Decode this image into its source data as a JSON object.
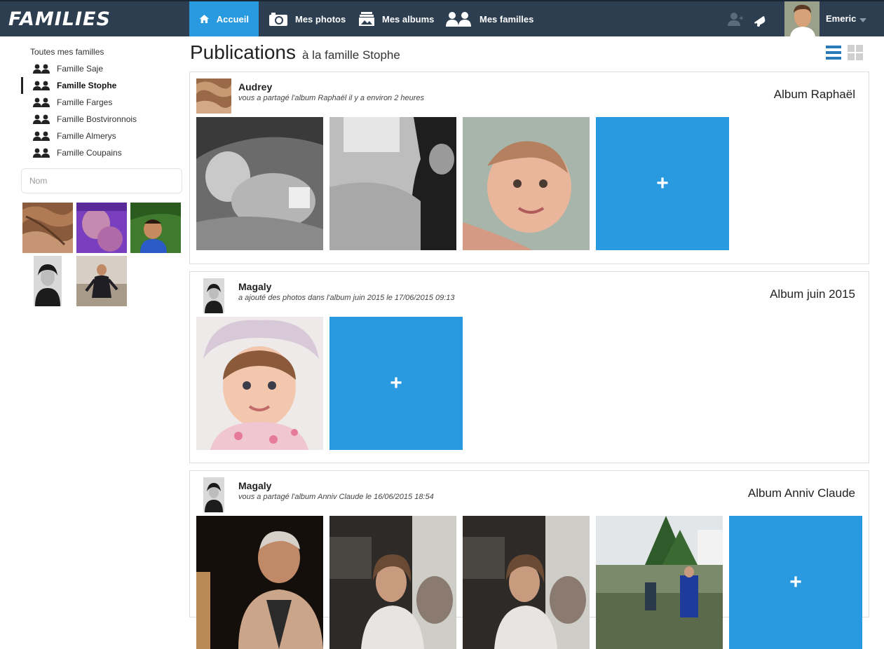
{
  "app": {
    "logo": "FAMILIES",
    "brand_color": "#2c3e50",
    "accent_color": "#2a9ae0"
  },
  "nav": {
    "items": [
      {
        "label": "Accueil",
        "icon": "home-icon",
        "active": true
      },
      {
        "label": "Mes photos",
        "icon": "camera-icon",
        "active": false
      },
      {
        "label": "Mes albums",
        "icon": "album-icon",
        "active": false
      },
      {
        "label": "Mes familles",
        "icon": "family-icon",
        "active": false
      }
    ]
  },
  "user": {
    "name": "Emeric"
  },
  "sidebar": {
    "title": "Toutes mes familles",
    "families": [
      {
        "label": "Famille Saje",
        "active": false
      },
      {
        "label": "Famille Stophe",
        "active": true
      },
      {
        "label": "Famille Farges",
        "active": false
      },
      {
        "label": "Famille Bostvironnois",
        "active": false
      },
      {
        "label": "Famille Almerys",
        "active": false
      },
      {
        "label": "Famille Coupains",
        "active": false
      }
    ],
    "search": {
      "placeholder": "Nom",
      "value": ""
    }
  },
  "main": {
    "title": "Publications",
    "subtitle": "à la famille Stophe"
  },
  "posts": [
    {
      "author": "Audrey",
      "action": "vous a partagé l'album Raphaël il y a environ 2 heures",
      "album": "Album Raphaël",
      "plus_label": "+"
    },
    {
      "author": "Magaly",
      "action": "a ajouté des photos dans l'album juin 2015 le 17/06/2015 09:13",
      "album": "Album juin 2015",
      "plus_label": "+"
    },
    {
      "author": "Magaly",
      "action": "vous a partagé l'album Anniv Claude le 16/06/2015 18:54",
      "album": "Album Anniv Claude",
      "plus_label": "+"
    }
  ]
}
